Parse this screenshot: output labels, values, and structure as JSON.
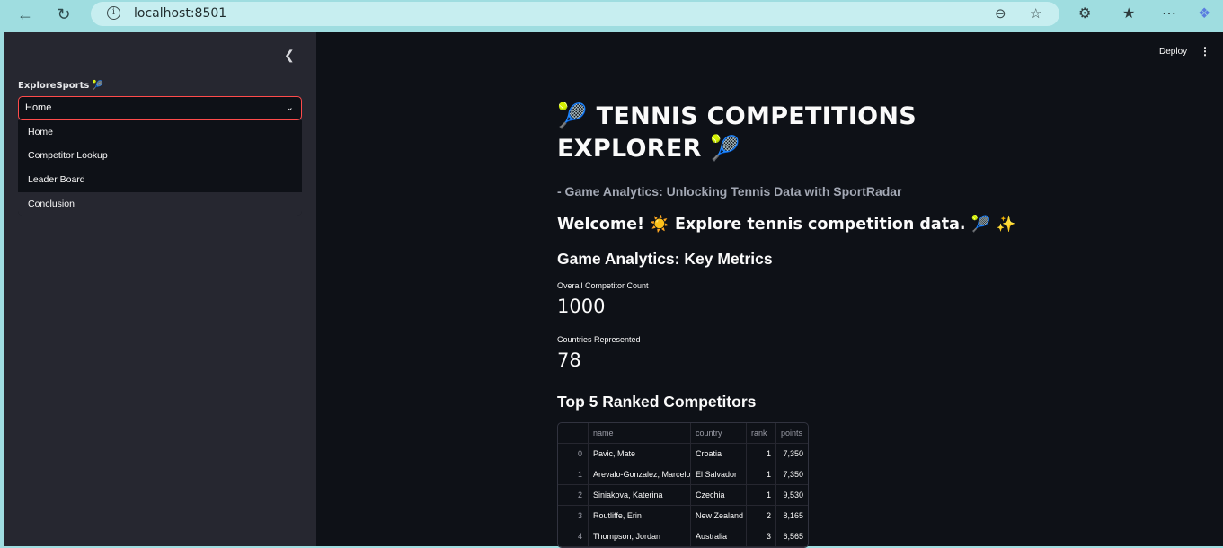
{
  "browser": {
    "url": "localhost:8501",
    "icons": [
      "back-arrow-icon",
      "reload-icon",
      "info-icon",
      "zoom-out-icon",
      "star-icon",
      "extensions-icon",
      "favorites-icon",
      "more-icon",
      "copilot-icon"
    ]
  },
  "sidebar": {
    "select_label": "ExploreSports 🎾",
    "selected_value": "Home",
    "options": [
      "Home",
      "Competitor Lookup",
      "Leader Board",
      "Conclusion"
    ]
  },
  "toolbar": {
    "deploy_label": "Deploy"
  },
  "main": {
    "title_line1": "🎾 TENNIS COMPETITIONS",
    "title_line2": "EXPLORER 🎾",
    "subtitle": "- Game Analytics: Unlocking Tennis Data with SportRadar",
    "welcome": "Welcome! ☀️ Explore tennis competition data. 🎾 ✨",
    "metrics_heading": "Game Analytics: Key Metrics",
    "metrics": [
      {
        "label": "Overall Competitor Count",
        "value": "1000"
      },
      {
        "label": "Countries Represented",
        "value": "78"
      }
    ],
    "table_heading": "Top 5 Ranked Competitors",
    "table": {
      "columns": [
        "",
        "name",
        "country",
        "rank",
        "points"
      ],
      "rows": [
        [
          "0",
          "Pavic, Mate",
          "Croatia",
          "1",
          "7,350"
        ],
        [
          "1",
          "Arevalo-Gonzalez, Marcelo",
          "El Salvador",
          "1",
          "7,350"
        ],
        [
          "2",
          "Siniakova, Katerina",
          "Czechia",
          "1",
          "9,530"
        ],
        [
          "3",
          "Routliffe, Erin",
          "New Zealand",
          "2",
          "8,165"
        ],
        [
          "4",
          "Thompson, Jordan",
          "Australia",
          "3",
          "6,565"
        ]
      ]
    }
  },
  "colors": {
    "accent": "#ff4b4b",
    "sidebar_bg": "#262730",
    "main_bg": "#0e1117",
    "browser_bg": "#9fdde0"
  }
}
